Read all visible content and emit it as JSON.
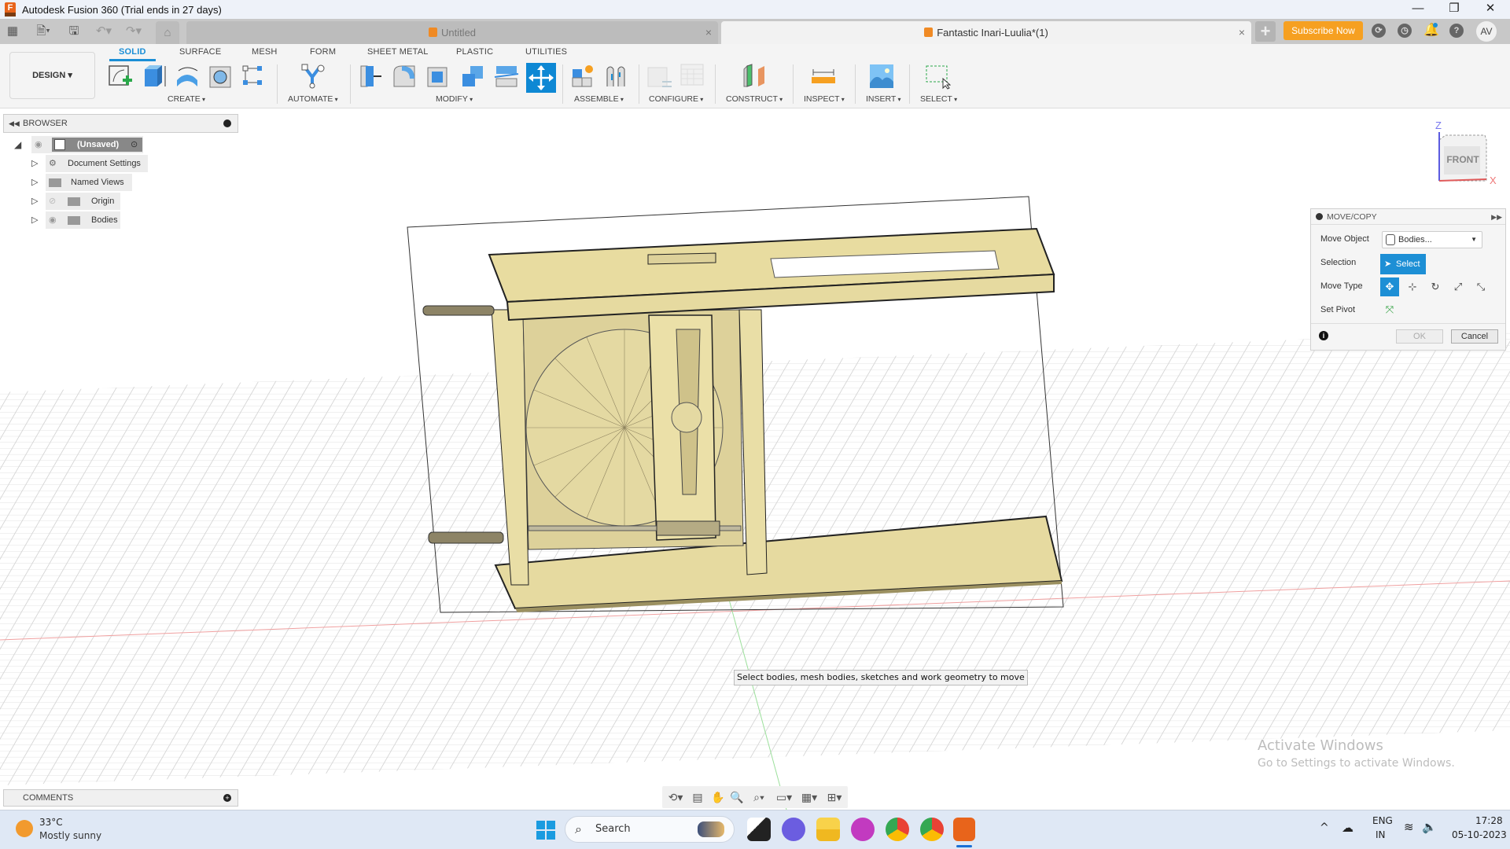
{
  "window": {
    "title": "Autodesk Fusion 360 (Trial ends in 27 days)",
    "minimize": "—",
    "restore": "❐",
    "close": "✕"
  },
  "tabbar": {
    "icons": [
      "grid-icon",
      "file-icon",
      "save-icon",
      "undo-icon",
      "redo-icon",
      "home-icon"
    ],
    "tabs": [
      {
        "label": "Untitled",
        "close": "×"
      },
      {
        "label": "Fantastic Inari-Luulia*(1)",
        "close": "×"
      }
    ],
    "new_tab": "+",
    "subscribe": "Subscribe Now",
    "avatar": "AV"
  },
  "ribbon": {
    "workspace": "DESIGN ▾",
    "tabs": [
      "SOLID",
      "SURFACE",
      "MESH",
      "FORM",
      "SHEET METAL",
      "PLASTIC",
      "UTILITIES"
    ],
    "groups": [
      "CREATE",
      "AUTOMATE",
      "MODIFY",
      "ASSEMBLE",
      "CONFIGURE",
      "CONSTRUCT",
      "INSPECT",
      "INSERT",
      "SELECT"
    ]
  },
  "browser": {
    "title": "BROWSER",
    "root": "(Unsaved)",
    "items": [
      "Document Settings",
      "Named Views",
      "Origin",
      "Bodies"
    ]
  },
  "viewcube": {
    "face": "FRONT",
    "z": "Z",
    "x": "X"
  },
  "move_copy": {
    "title": "MOVE/COPY",
    "move_object_label": "Move Object",
    "move_object_value": "Bodies...",
    "selection_label": "Selection",
    "selection_button": "Select",
    "move_type_label": "Move Type",
    "set_pivot_label": "Set Pivot",
    "ok": "OK",
    "cancel": "Cancel"
  },
  "tooltip": "Select bodies, mesh bodies, sketches and work geometry to move",
  "comments": {
    "title": "COMMENTS"
  },
  "activate": {
    "line1": "Activate Windows",
    "line2": "Go to Settings to activate Windows."
  },
  "taskbar": {
    "weather_temp": "33°C",
    "weather_desc": "Mostly sunny",
    "search": "Search",
    "lang1": "ENG",
    "lang2": "IN",
    "time": "17:28",
    "date": "05-10-2023"
  },
  "colors": {
    "accent": "#1a8ed6",
    "subscribe": "#f6a021",
    "body": "#e8dca0"
  }
}
